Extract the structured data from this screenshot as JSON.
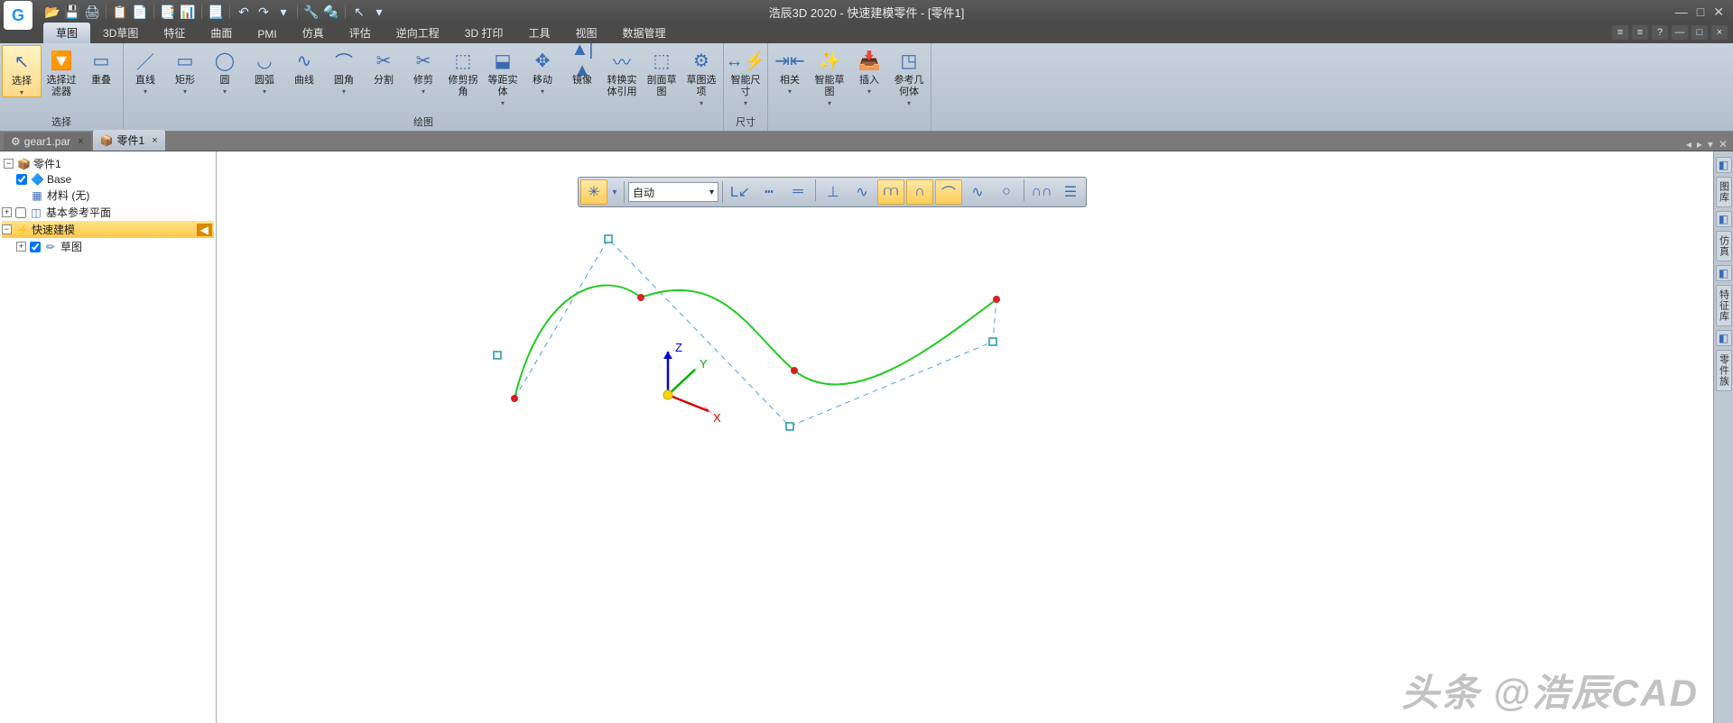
{
  "app": {
    "title": "浩辰3D 2020 - 快速建模零件 - [零件1]",
    "logo_letter": "G"
  },
  "qat": [
    "📂",
    "💾",
    "🖨",
    "|",
    "📋",
    "📄",
    "|",
    "📑",
    "📊",
    "|",
    "📃",
    "|",
    "↶",
    "↷",
    "▾",
    "|",
    "🔧",
    "🔩",
    "|",
    "↖",
    "▾"
  ],
  "tabs": [
    "草图",
    "3D草图",
    "特征",
    "曲面",
    "PMI",
    "仿真",
    "评估",
    "逆向工程",
    "3D 打印",
    "工具",
    "视图",
    "数据管理"
  ],
  "active_tab": 0,
  "ribbon_right": [
    "≡",
    "≡",
    "?",
    "—",
    "□",
    "×"
  ],
  "ribbon": {
    "g1": {
      "label": "选择",
      "items": [
        {
          "icon": "↖",
          "label": "选择",
          "dd": true,
          "sel": true
        },
        {
          "icon": "🔽",
          "label": "选择过滤器",
          "dd": false
        },
        {
          "icon": "▭",
          "label": "重叠",
          "dd": false
        }
      ]
    },
    "g2": {
      "label": "绘图",
      "items": [
        {
          "icon": "／",
          "label": "直线",
          "dd": true
        },
        {
          "icon": "▭",
          "label": "矩形",
          "dd": true
        },
        {
          "icon": "◯",
          "label": "圆",
          "dd": true
        },
        {
          "icon": "◡",
          "label": "圆弧",
          "dd": true
        },
        {
          "icon": "∿",
          "label": "曲线",
          "dd": false
        },
        {
          "icon": "⌒",
          "label": "圆角",
          "dd": true
        },
        {
          "icon": "✂",
          "label": "分割",
          "dd": false
        },
        {
          "icon": "✂",
          "label": "修剪",
          "dd": true
        },
        {
          "icon": "⬚",
          "label": "修剪拐角",
          "dd": false
        },
        {
          "icon": "⬓",
          "label": "等距实体",
          "dd": true
        },
        {
          "icon": "✥",
          "label": "移动",
          "dd": true
        },
        {
          "icon": "▲|▲",
          "label": "镜像",
          "dd": false
        },
        {
          "icon": "〰",
          "label": "转换实体引用",
          "dd": false
        },
        {
          "icon": "⬚",
          "label": "剖面草图",
          "dd": false
        },
        {
          "icon": "⚙",
          "label": "草图选项",
          "dd": true
        }
      ]
    },
    "g3": {
      "label": "尺寸",
      "items": [
        {
          "icon": "↔⚡",
          "label": "智能尺寸",
          "dd": true
        }
      ]
    },
    "g4": {
      "label": "",
      "items": [
        {
          "icon": "⇥⇤",
          "label": "相关",
          "dd": true
        },
        {
          "icon": "✨",
          "label": "智能草图",
          "dd": true
        },
        {
          "icon": "📥",
          "label": "插入",
          "dd": true
        },
        {
          "icon": "◳",
          "label": "参考几何体",
          "dd": true
        }
      ]
    }
  },
  "doc_tabs": [
    {
      "icon": "⚙",
      "label": "gear1.par",
      "active": false
    },
    {
      "icon": "📦",
      "label": "零件1",
      "active": true
    }
  ],
  "doc_nav": [
    "◂",
    "▸",
    "▾",
    "✕"
  ],
  "tree": {
    "root": {
      "icon": "📦",
      "label": "零件1"
    },
    "base": {
      "icon": "🔷",
      "label": "Base"
    },
    "material": {
      "icon": "▦",
      "label": "材料 (无)"
    },
    "ref_planes": {
      "icon": "◫",
      "label": "基本参考平面"
    },
    "quick_model": {
      "icon": "⚡",
      "label": "快速建模"
    },
    "sketch": {
      "icon": "✏",
      "label": "草图"
    }
  },
  "side": [
    "图库",
    "仿真",
    "特征库",
    "零件族"
  ],
  "float": {
    "combo": "自动",
    "btns": [
      "L↙",
      "┅",
      "═",
      "⊥",
      "∿",
      "⩋",
      "∩",
      "⌒",
      "∿",
      "○",
      "∩∩",
      "☰"
    ]
  },
  "axes": {
    "x": "X",
    "y": "Y",
    "z": "Z"
  },
  "watermark": "头条 @浩辰CAD"
}
